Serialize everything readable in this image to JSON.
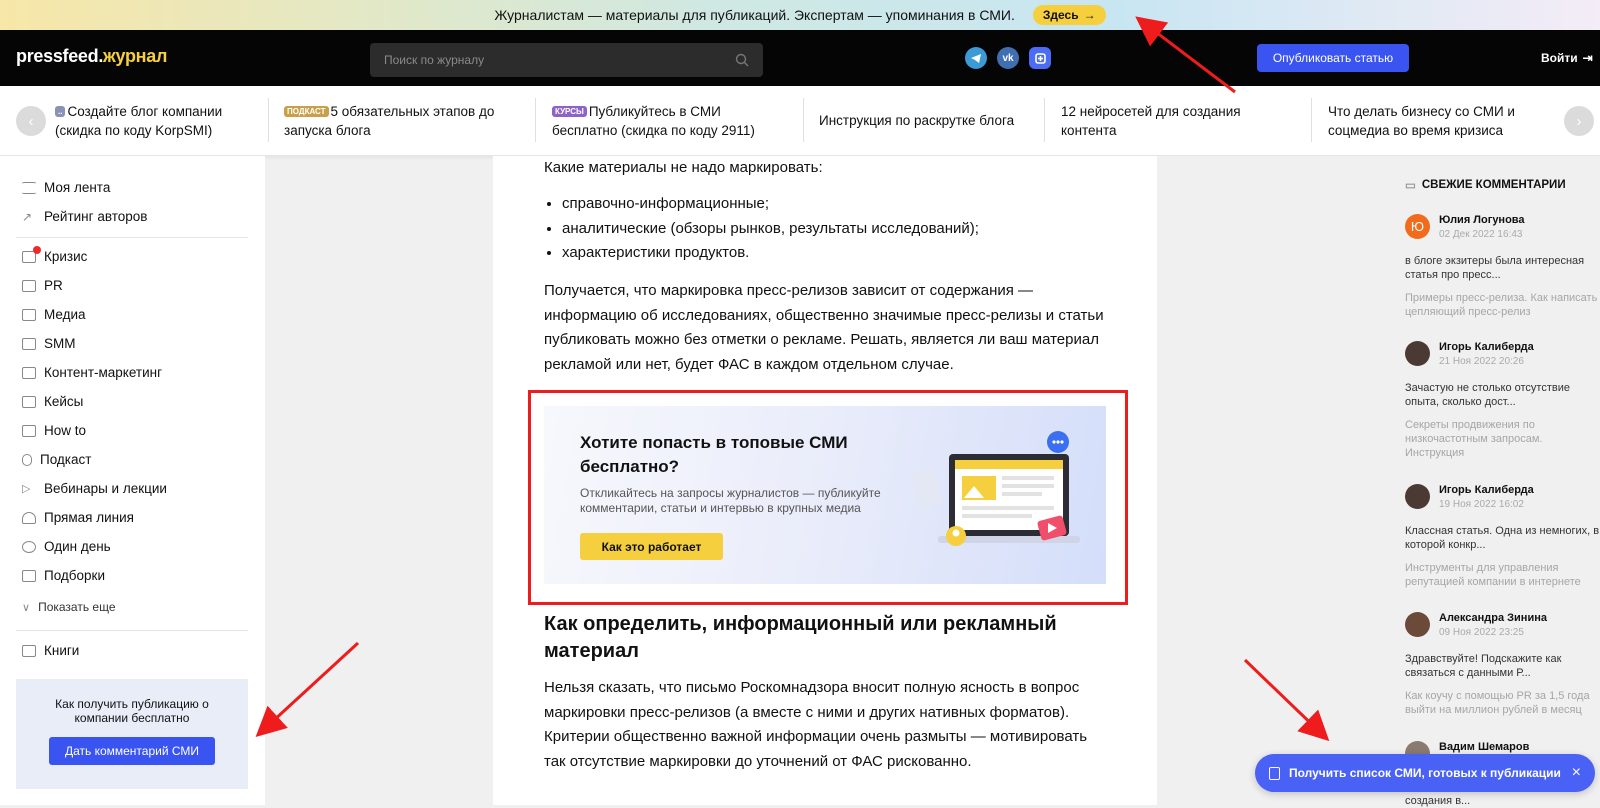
{
  "topbar": {
    "text": "Журналистам — материалы для публикаций. Экспертам — упоминания в СМИ.",
    "link": "Здесь"
  },
  "header": {
    "logo_main": "pressfeed.",
    "logo_accent": "журнал",
    "search_placeholder": "Поиск по журналу",
    "socials": [
      "telegram-icon",
      "vk-icon",
      "max-icon"
    ],
    "publish": "Опубликовать статью",
    "login": "Войти"
  },
  "promo": {
    "items": [
      {
        "badge": "",
        "text": "Создайте блог компании (скидка по коду KorpSMI)"
      },
      {
        "badge": "ПОДКАСТ",
        "text": "5 обязательных этапов до запуска блога"
      },
      {
        "badge": "КУРСЫ",
        "text": "Публикуйтесь в СМИ бесплатно (скидка по коду 2911)"
      },
      {
        "badge": "",
        "text": "Инструкция по раскрутке блога"
      },
      {
        "badge": "",
        "text": "12 нейросетей для создания контента"
      },
      {
        "badge": "",
        "text": "Что делать бизнесу со СМИ и соцмедиа во время кризиса"
      }
    ]
  },
  "sidebar": {
    "top": [
      "Моя лента",
      "Рейтинг авторов"
    ],
    "cats": [
      "Кризис",
      "PR",
      "Медиа",
      "SMM",
      "Контент-маркетинг",
      "Кейсы",
      "How to",
      "Подкаст",
      "Вебинары и лекции",
      "Прямая линия",
      "Один день",
      "Подборки"
    ],
    "more": "Показать еще",
    "books": "Книги",
    "promo_text": "Как получить публикацию о компании бесплатно",
    "promo_btn": "Дать комментарий СМИ"
  },
  "article": {
    "p1": "Какие материалы не надо маркировать:",
    "bullets": [
      "справочно-информационные;",
      "аналитические (обзоры рынков, результаты исследований);",
      "характеристики продуктов."
    ],
    "p2": "Получается, что маркировка пресс-релизов зависит от содержания — информацию об исследованиях, общественно значимые пресс-релизы и статьи публиковать можно без отметки о рекламе. Решать, является ли ваш материал рекламой или нет, будет ФАС в каждом отдельном случае.",
    "banner": {
      "title": "Хотите попасть в топовые СМИ бесплатно?",
      "desc": "Откликайтесь на запросы журналистов — публикуйте комментарии, статьи и интервью в крупных медиа",
      "btn": "Как это работает"
    },
    "h2": "Как определить, информационный или рекламный материал",
    "p3": "Нельзя сказать, что письмо Роскомнадзора вносит полную ясность в вопрос маркировки пресс-релизов (а вместе с ними и других нативных форматов). Критерии общественно важной информации очень размыты — мотивировать так отсутствие маркировки до уточнений от ФАС рискованно."
  },
  "comments": {
    "title": "СВЕЖИЕ КОММЕНТАРИИ",
    "items": [
      {
        "initial": "Ю",
        "name": "Юлия Логунова",
        "date": "02 Дек 2022 16:43",
        "text": "в блоге экзитеры была интересная статья про пресс...",
        "article": "Примеры пресс-релиза. Как написать цепляющий пресс-релиз"
      },
      {
        "initial": "",
        "name": "Игорь Калиберда",
        "date": "21 Ноя 2022 20:26",
        "text": "Зачастую не столько отсутствие опыта, сколько дост...",
        "article": "Секреты продвижения по низкочастотным запросам. Инструкция"
      },
      {
        "initial": "",
        "name": "Игорь Калиберда",
        "date": "19 Ноя 2022 16:02",
        "text": "Классная статья. Одна из немногих, в которой конкр...",
        "article": "Инструменты для управления репутацией компании в интернете"
      },
      {
        "initial": "",
        "name": "Александра Зинина",
        "date": "09 Ноя 2022 23:25",
        "text": "Здравствуйте! Подскажите как связаться с данными Р...",
        "article": "Как коучу с помощью PR за 1,5 года выйти на миллион рублей в месяц"
      },
      {
        "initial": "",
        "name": "Вадим Шемаров",
        "date": "",
        "text": "",
        "article": "создания в..."
      }
    ]
  },
  "float_btn": "Получить список СМИ, готовых к публикации",
  "colors": {
    "accent": "#3a54f2",
    "yellow": "#f6cf3f",
    "annotation": "#ee1c1c"
  }
}
